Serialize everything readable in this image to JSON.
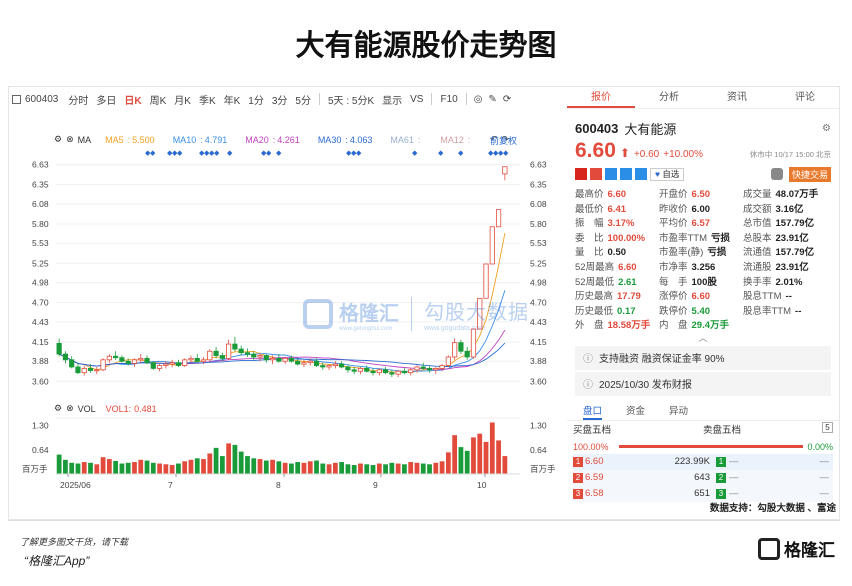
{
  "title": "大有能源股价走势图",
  "toolbar": {
    "code": "600403",
    "items": [
      "分时",
      "多日",
      "日K",
      "周K",
      "月K",
      "季K",
      "年K",
      "1分",
      "3分",
      "5分",
      "5天 : 5分K",
      "显示",
      "VS",
      "F10"
    ],
    "active": "日K"
  },
  "ma": {
    "label": "MA",
    "items": [
      {
        "name": "MA5",
        "val": "5.500",
        "color": "#f0a020"
      },
      {
        "name": "MA10",
        "val": "4.791",
        "color": "#3a8ee6"
      },
      {
        "name": "MA20",
        "val": "4.261",
        "color": "#c040c0"
      },
      {
        "name": "MA30",
        "val": "4.063",
        "color": "#2a6ad0"
      },
      {
        "name": "MA61",
        "val": "",
        "color": "#9ab0d0"
      },
      {
        "name": "MA12",
        "val": "",
        "color": "#d0a0a0"
      }
    ],
    "fq": "前复权"
  },
  "vol": {
    "label": "VOL",
    "vol1_label": "VOL1:",
    "vol1_val": "0.481",
    "ticks": [
      "1.30",
      "0.64",
      "百万手"
    ]
  },
  "yticks": [
    "6.63",
    "6.35",
    "6.08",
    "5.80",
    "5.53",
    "5.25",
    "4.98",
    "4.70",
    "4.43",
    "4.15",
    "3.88",
    "3.60"
  ],
  "xticks": [
    "2025/06",
    "7",
    "8",
    "9",
    "10"
  ],
  "watermark": {
    "brand": "格隆汇",
    "brand_url": "www.gelonghui.com",
    "data": "勾股大数据",
    "data_url": "www.gogudata.com"
  },
  "chart_data": {
    "type": "candlestick",
    "title": "",
    "ylim": [
      3.45,
      6.75
    ],
    "x_labels": [
      "2025/06",
      "7",
      "8",
      "9",
      "10"
    ],
    "candles": [
      [
        4.13,
        4.2,
        3.95,
        3.98
      ],
      [
        3.98,
        4.02,
        3.85,
        3.9
      ],
      [
        3.9,
        3.95,
        3.78,
        3.8
      ],
      [
        3.8,
        3.86,
        3.7,
        3.72
      ],
      [
        3.72,
        3.82,
        3.68,
        3.78
      ],
      [
        3.78,
        3.84,
        3.72,
        3.75
      ],
      [
        3.75,
        3.8,
        3.7,
        3.76
      ],
      [
        3.76,
        3.92,
        3.74,
        3.9
      ],
      [
        3.9,
        3.98,
        3.86,
        3.95
      ],
      [
        3.95,
        4.02,
        3.9,
        3.93
      ],
      [
        3.93,
        3.96,
        3.86,
        3.88
      ],
      [
        3.88,
        3.92,
        3.82,
        3.85
      ],
      [
        3.85,
        3.92,
        3.8,
        3.9
      ],
      [
        3.9,
        3.98,
        3.86,
        3.92
      ],
      [
        3.92,
        3.96,
        3.84,
        3.86
      ],
      [
        3.86,
        3.88,
        3.76,
        3.78
      ],
      [
        3.78,
        3.84,
        3.74,
        3.82
      ],
      [
        3.82,
        3.88,
        3.78,
        3.84
      ],
      [
        3.84,
        3.9,
        3.8,
        3.86
      ],
      [
        3.86,
        3.9,
        3.8,
        3.82
      ],
      [
        3.82,
        3.92,
        3.8,
        3.9
      ],
      [
        3.9,
        3.96,
        3.86,
        3.92
      ],
      [
        3.92,
        3.98,
        3.86,
        3.88
      ],
      [
        3.88,
        3.94,
        3.84,
        3.9
      ],
      [
        3.9,
        4.05,
        3.88,
        4.02
      ],
      [
        4.02,
        4.08,
        3.92,
        3.96
      ],
      [
        3.96,
        4.0,
        3.88,
        3.92
      ],
      [
        3.92,
        4.18,
        3.9,
        4.12
      ],
      [
        4.12,
        4.22,
        4.02,
        4.05
      ],
      [
        4.05,
        4.1,
        3.96,
        4.0
      ],
      [
        4.0,
        4.06,
        3.94,
        3.98
      ],
      [
        3.98,
        4.02,
        3.9,
        3.94
      ],
      [
        3.94,
        4.0,
        3.88,
        3.96
      ],
      [
        3.96,
        3.98,
        3.86,
        3.9
      ],
      [
        3.9,
        3.96,
        3.84,
        3.92
      ],
      [
        3.92,
        3.98,
        3.86,
        3.88
      ],
      [
        3.88,
        3.94,
        3.84,
        3.92
      ],
      [
        3.92,
        3.96,
        3.86,
        3.88
      ],
      [
        3.88,
        3.92,
        3.82,
        3.84
      ],
      [
        3.84,
        3.9,
        3.8,
        3.86
      ],
      [
        3.86,
        3.92,
        3.82,
        3.88
      ],
      [
        3.88,
        3.92,
        3.8,
        3.82
      ],
      [
        3.82,
        3.86,
        3.76,
        3.8
      ],
      [
        3.8,
        3.84,
        3.76,
        3.82
      ],
      [
        3.82,
        3.88,
        3.78,
        3.84
      ],
      [
        3.84,
        3.88,
        3.78,
        3.8
      ],
      [
        3.8,
        3.82,
        3.72,
        3.76
      ],
      [
        3.76,
        3.8,
        3.7,
        3.74
      ],
      [
        3.74,
        3.8,
        3.7,
        3.78
      ],
      [
        3.78,
        3.82,
        3.72,
        3.74
      ],
      [
        3.74,
        3.78,
        3.68,
        3.72
      ],
      [
        3.72,
        3.78,
        3.68,
        3.76
      ],
      [
        3.76,
        3.8,
        3.7,
        3.72
      ],
      [
        3.72,
        3.76,
        3.66,
        3.7
      ],
      [
        3.7,
        3.76,
        3.66,
        3.74
      ],
      [
        3.74,
        3.78,
        3.7,
        3.72
      ],
      [
        3.72,
        3.78,
        3.68,
        3.76
      ],
      [
        3.76,
        3.82,
        3.72,
        3.8
      ],
      [
        3.8,
        3.86,
        3.76,
        3.78
      ],
      [
        3.78,
        3.82,
        3.72,
        3.76
      ],
      [
        3.76,
        3.8,
        3.7,
        3.78
      ],
      [
        3.78,
        3.84,
        3.74,
        3.82
      ],
      [
        3.82,
        3.96,
        3.8,
        3.94
      ],
      [
        3.94,
        4.2,
        3.9,
        4.14
      ],
      [
        4.14,
        4.18,
        3.98,
        4.02
      ],
      [
        4.02,
        4.08,
        3.9,
        3.94
      ],
      [
        3.94,
        4.34,
        3.92,
        4.33
      ],
      [
        4.33,
        4.76,
        4.33,
        4.76
      ],
      [
        4.76,
        5.24,
        4.76,
        5.24
      ],
      [
        5.24,
        5.76,
        5.24,
        5.76
      ],
      [
        5.76,
        6.0,
        5.76,
        6.0
      ],
      [
        6.5,
        6.6,
        6.41,
        6.6
      ]
    ],
    "volume": [
      0.52,
      0.38,
      0.3,
      0.28,
      0.32,
      0.3,
      0.26,
      0.45,
      0.4,
      0.35,
      0.28,
      0.3,
      0.32,
      0.38,
      0.36,
      0.3,
      0.28,
      0.26,
      0.24,
      0.28,
      0.34,
      0.38,
      0.42,
      0.4,
      0.55,
      0.7,
      0.48,
      0.82,
      0.78,
      0.6,
      0.48,
      0.42,
      0.4,
      0.36,
      0.38,
      0.34,
      0.3,
      0.28,
      0.32,
      0.3,
      0.34,
      0.36,
      0.28,
      0.26,
      0.3,
      0.32,
      0.26,
      0.24,
      0.28,
      0.26,
      0.24,
      0.28,
      0.26,
      0.3,
      0.28,
      0.26,
      0.32,
      0.3,
      0.28,
      0.26,
      0.3,
      0.34,
      0.58,
      1.04,
      0.72,
      0.62,
      0.98,
      1.08,
      0.86,
      1.38,
      0.9,
      0.48
    ],
    "vol_ylim": [
      0,
      1.5
    ]
  },
  "right": {
    "tabs": [
      "报价",
      "分析",
      "资讯",
      "评论"
    ],
    "code": "600403",
    "name": "大有能源",
    "price": "6.60",
    "arrow": "⬆",
    "change": "+0.60",
    "pct": "+10.00%",
    "status": "休市中 10/17 15:00 北京",
    "tag_fav": "自选",
    "tag_trade": "快捷交易",
    "stats": [
      [
        "最高价",
        "6.60",
        "开盘价",
        "6.50",
        "成交量",
        "48.07万手"
      ],
      [
        "最低价",
        "6.41",
        "昨收价",
        "6.00",
        "成交额",
        "3.16亿"
      ],
      [
        "振　幅",
        "3.17%",
        "平均价",
        "6.57",
        "总市值",
        "157.79亿"
      ],
      [
        "委　比",
        "100.00%",
        "市盈率TTM",
        "亏损",
        "总股本",
        "23.91亿"
      ],
      [
        "量　比",
        "0.50",
        "市盈率(静)",
        "亏损",
        "流通值",
        "157.79亿"
      ],
      [
        "52周最高",
        "6.60",
        "市净率",
        "3.256",
        "流通股",
        "23.91亿"
      ],
      [
        "52周最低",
        "2.61",
        "每　手",
        "100股",
        "换手率",
        "2.01%"
      ],
      [
        "历史最高",
        "17.79",
        "涨停价",
        "6.60",
        "股息TTM",
        "--"
      ],
      [
        "历史最低",
        "0.17",
        "跌停价",
        "5.40",
        "股息率TTM",
        "--"
      ],
      [
        "外　盘",
        "18.58万手",
        "内　盘",
        "29.4万手",
        "",
        ""
      ]
    ],
    "stat_colors": [
      [
        "red",
        "red",
        "bk"
      ],
      [
        "red",
        "bk",
        "bk"
      ],
      [
        "red",
        "red",
        "bk"
      ],
      [
        "red",
        "bk",
        "bk"
      ],
      [
        "bk",
        "bk",
        "bk"
      ],
      [
        "red",
        "bk",
        "bk"
      ],
      [
        "grn",
        "bk",
        "bk"
      ],
      [
        "red",
        "red",
        "bk"
      ],
      [
        "grn",
        "grn",
        "bk"
      ],
      [
        "red",
        "grn",
        "bk"
      ]
    ],
    "banner1": "支持融资 融资保证金率 90%",
    "banner2": "2025/10/30 发布财报",
    "subtabs": [
      "盘口",
      "资金",
      "异动"
    ],
    "ob_buy_label": "买盘五档",
    "ob_sell_label": "卖盘五档",
    "ob_buy_pct": "100.00%",
    "ob_sell_pct": "0.00%",
    "orders": [
      {
        "i": "1",
        "p": "6.60",
        "v": "223.99K",
        "j": "1",
        "sp": "—",
        "sv": "—"
      },
      {
        "i": "2",
        "p": "6.59",
        "v": "643",
        "j": "2",
        "sp": "—",
        "sv": "—"
      },
      {
        "i": "3",
        "p": "6.58",
        "v": "651",
        "j": "3",
        "sp": "—",
        "sv": "—"
      }
    ]
  },
  "source": "数据支持：勾股大数据 、富途",
  "footer": {
    "line1": "了解更多图文干货，请下载",
    "line2": "“格隆汇App”",
    "logo": "格隆汇"
  }
}
